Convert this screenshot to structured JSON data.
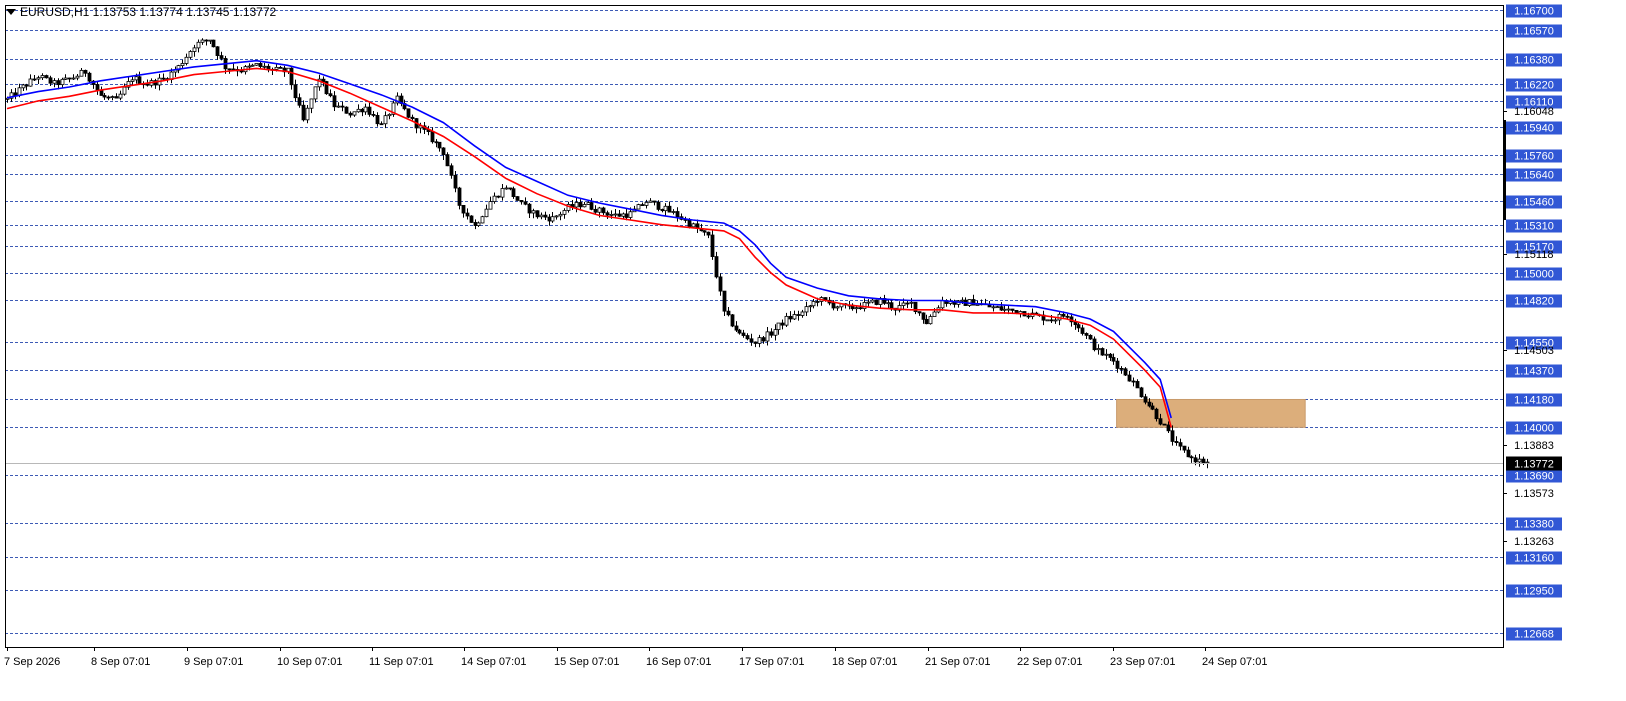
{
  "header": {
    "symbol_line": "EURUSD,H1  1.13753 1.13774 1.13745 1.13772"
  },
  "colors": {
    "grid": "#3d5ab5",
    "level_bg": "#3157d5",
    "ma_fast": "#ff0000",
    "ma_slow": "#0000ff",
    "zone": "#dcae7b",
    "current_bg": "#000000"
  },
  "chart_data": {
    "type": "candlestick",
    "symbol": "EURUSD",
    "timeframe": "H1",
    "ohlc_last": {
      "open": 1.13753,
      "high": 1.13774,
      "low": 1.13745,
      "close": 1.13772
    },
    "ylim": [
      1.1258,
      1.1673
    ],
    "x_labels": [
      "7 Sep 2026",
      "8 Sep 07:01",
      "9 Sep 07:01",
      "10 Sep 07:01",
      "11 Sep 07:01",
      "14 Sep 07:01",
      "15 Sep 07:01",
      "16 Sep 07:01",
      "17 Sep 07:01",
      "18 Sep 07:01",
      "21 Sep 07:01",
      "22 Sep 07:01",
      "23 Sep 07:01",
      "24 Sep 07:01"
    ],
    "highlighted_levels": [
      "1.16700",
      "1.16570",
      "1.16380",
      "1.16220",
      "1.16110",
      "1.15940",
      "1.15760",
      "1.15640",
      "1.15460",
      "1.15310",
      "1.15170",
      "1.15000",
      "1.14820",
      "1.14550",
      "1.14370",
      "1.14180",
      "1.14000",
      "1.13690",
      "1.13380",
      "1.13160",
      "1.12950",
      "1.12668"
    ],
    "plain_ticks": [
      "1.16048",
      "1.15118",
      "1.14503",
      "1.13883",
      "1.13573",
      "1.13263"
    ],
    "current_price": "1.13772",
    "zone": {
      "low": 1.14,
      "high": 1.1418,
      "from": "23 Sep",
      "to": "24 Sep"
    },
    "ma_fast_path": [
      [
        0,
        1.1606
      ],
      [
        2,
        1.1611
      ],
      [
        4,
        1.1614
      ],
      [
        6,
        1.1618
      ],
      [
        8,
        1.1621
      ],
      [
        10,
        1.1624
      ],
      [
        12,
        1.1628
      ],
      [
        14,
        1.163
      ],
      [
        16,
        1.1632
      ],
      [
        18,
        1.163
      ],
      [
        20,
        1.1624
      ],
      [
        22,
        1.1616
      ],
      [
        24,
        1.1607
      ],
      [
        26,
        1.1598
      ],
      [
        28,
        1.1588
      ],
      [
        30,
        1.1575
      ],
      [
        32,
        1.1561
      ],
      [
        34,
        1.1551
      ],
      [
        36,
        1.1543
      ],
      [
        38,
        1.1537
      ],
      [
        40,
        1.1534
      ],
      [
        42,
        1.1531
      ],
      [
        44,
        1.1529
      ],
      [
        46,
        1.1527
      ],
      [
        47,
        1.1522
      ],
      [
        48,
        1.151
      ],
      [
        49,
        1.15
      ],
      [
        50,
        1.1492
      ],
      [
        52,
        1.1483
      ],
      [
        54,
        1.1479
      ],
      [
        56,
        1.1477
      ],
      [
        58,
        1.1476
      ],
      [
        60,
        1.1476
      ],
      [
        62,
        1.1474
      ],
      [
        64,
        1.1474
      ],
      [
        66,
        1.1473
      ],
      [
        68,
        1.147
      ],
      [
        69.5,
        1.1466
      ],
      [
        71,
        1.1457
      ],
      [
        72,
        1.1447
      ],
      [
        73,
        1.1437
      ],
      [
        74,
        1.1426
      ],
      [
        74.7,
        1.14
      ]
    ],
    "ma_slow_path": [
      [
        0,
        1.1613
      ],
      [
        2,
        1.1617
      ],
      [
        4,
        1.162
      ],
      [
        6,
        1.1624
      ],
      [
        8,
        1.1627
      ],
      [
        10,
        1.163
      ],
      [
        12,
        1.1633
      ],
      [
        14,
        1.1635
      ],
      [
        16,
        1.1637
      ],
      [
        18,
        1.1634
      ],
      [
        20,
        1.1629
      ],
      [
        22,
        1.1622
      ],
      [
        24,
        1.1615
      ],
      [
        26,
        1.1607
      ],
      [
        28,
        1.1597
      ],
      [
        30,
        1.1582
      ],
      [
        32,
        1.1568
      ],
      [
        34,
        1.1559
      ],
      [
        36,
        1.155
      ],
      [
        38,
        1.1545
      ],
      [
        40,
        1.1541
      ],
      [
        42,
        1.1537
      ],
      [
        44,
        1.1534
      ],
      [
        46,
        1.1532
      ],
      [
        47,
        1.1527
      ],
      [
        48,
        1.1518
      ],
      [
        49,
        1.1506
      ],
      [
        50,
        1.1497
      ],
      [
        52,
        1.149
      ],
      [
        54,
        1.1485
      ],
      [
        56,
        1.1483
      ],
      [
        58,
        1.1482
      ],
      [
        60,
        1.1482
      ],
      [
        62,
        1.148
      ],
      [
        64,
        1.1479
      ],
      [
        66,
        1.1478
      ],
      [
        68,
        1.1474
      ],
      [
        69.5,
        1.147
      ],
      [
        71,
        1.1462
      ],
      [
        72,
        1.1452
      ],
      [
        73,
        1.1442
      ],
      [
        74,
        1.1431
      ],
      [
        74.7,
        1.1406
      ]
    ],
    "price_path": [
      [
        0,
        1.1612
      ],
      [
        1,
        1.162
      ],
      [
        2,
        1.1627
      ],
      [
        3,
        1.1622
      ],
      [
        4,
        1.1625
      ],
      [
        5,
        1.163
      ],
      [
        6,
        1.1614
      ],
      [
        7,
        1.1611
      ],
      [
        8,
        1.1626
      ],
      [
        9,
        1.1622
      ],
      [
        10,
        1.1625
      ],
      [
        11,
        1.1633
      ],
      [
        12,
        1.1647
      ],
      [
        13,
        1.1651
      ],
      [
        14,
        1.1633
      ],
      [
        15,
        1.1631
      ],
      [
        16,
        1.1634
      ],
      [
        17,
        1.1631
      ],
      [
        18,
        1.163
      ],
      [
        19,
        1.1598
      ],
      [
        20,
        1.1626
      ],
      [
        21,
        1.1608
      ],
      [
        22,
        1.1603
      ],
      [
        23,
        1.1607
      ],
      [
        24,
        1.1595
      ],
      [
        25,
        1.1612
      ],
      [
        26,
        1.1598
      ],
      [
        27,
        1.1589
      ],
      [
        28,
        1.1578
      ],
      [
        29,
        1.1544
      ],
      [
        30,
        1.153
      ],
      [
        31,
        1.1546
      ],
      [
        32,
        1.1556
      ],
      [
        33,
        1.1544
      ],
      [
        34,
        1.1537
      ],
      [
        35,
        1.1535
      ],
      [
        36,
        1.1542
      ],
      [
        37,
        1.1545
      ],
      [
        38,
        1.154
      ],
      [
        39,
        1.1537
      ],
      [
        40,
        1.1538
      ],
      [
        41,
        1.1546
      ],
      [
        42,
        1.1542
      ],
      [
        43,
        1.1537
      ],
      [
        44,
        1.153
      ],
      [
        45,
        1.1523
      ],
      [
        46,
        1.1474
      ],
      [
        47,
        1.146
      ],
      [
        48,
        1.1455
      ],
      [
        49,
        1.1461
      ],
      [
        50,
        1.147
      ],
      [
        51,
        1.1474
      ],
      [
        52,
        1.1483
      ],
      [
        53,
        1.1479
      ],
      [
        54,
        1.1477
      ],
      [
        55,
        1.1479
      ],
      [
        56,
        1.1482
      ],
      [
        57,
        1.1477
      ],
      [
        58,
        1.148
      ],
      [
        59,
        1.1468
      ],
      [
        60,
        1.1482
      ],
      [
        61,
        1.148
      ],
      [
        62,
        1.1481
      ],
      [
        63,
        1.1478
      ],
      [
        64,
        1.1476
      ],
      [
        65,
        1.1475
      ],
      [
        66,
        1.1472
      ],
      [
        67,
        1.147
      ],
      [
        68,
        1.1473
      ],
      [
        69,
        1.1462
      ],
      [
        70,
        1.1449
      ],
      [
        71,
        1.1443
      ],
      [
        72,
        1.1432
      ],
      [
        73,
        1.1418
      ],
      [
        74,
        1.1404
      ],
      [
        75,
        1.1388
      ],
      [
        76,
        1.138
      ],
      [
        77,
        1.1377
      ]
    ]
  }
}
